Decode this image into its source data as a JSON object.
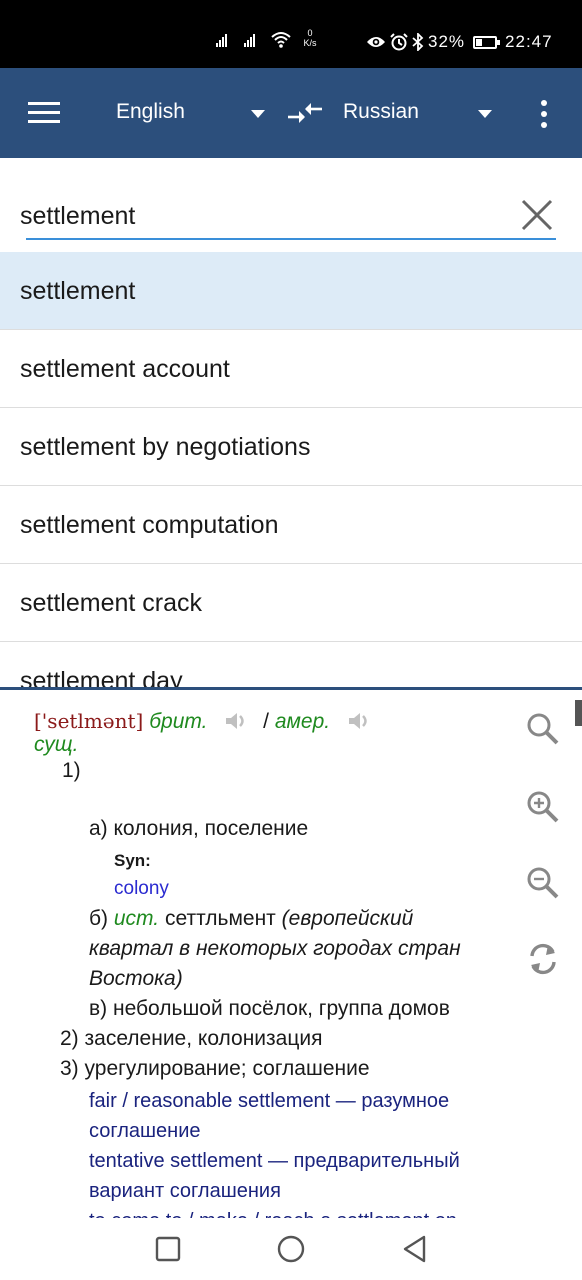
{
  "status_bar": {
    "signal_1": ".ıll",
    "signal_2": ".ıll",
    "net_speed_value": "0",
    "net_speed_unit": "K/s",
    "battery_text": "32%",
    "battery_level": 0.32,
    "time": "22:47",
    "icons": [
      "signal-icon",
      "signal-icon",
      "wifi-icon",
      "eye-icon",
      "alarm-icon",
      "bluetooth-icon",
      "battery-icon"
    ]
  },
  "app_bar": {
    "source_language": "English",
    "target_language": "Russian",
    "icons": [
      "menu-icon",
      "dropdown-icon",
      "swap-languages-icon",
      "dropdown-icon",
      "more-vert-icon"
    ]
  },
  "search": {
    "query": "settlement",
    "clear_icon": "close-icon",
    "underline_color": "#3a8fd9"
  },
  "suggestions": [
    "settlement",
    "settlement account",
    "settlement by negotiations",
    "settlement computation",
    "settlement crack",
    "settlement day"
  ],
  "article": {
    "transcription": "['setlmənt]",
    "brit_label": "брит.",
    "slash": "/",
    "amer_label": "амер.",
    "pos": "сущ.",
    "sense_1": "1)",
    "sense_1a": "а) колония, поселение",
    "syn_label": "Syn:",
    "syn_value": "colony",
    "sense_1b_prefix": "б)",
    "sense_1b_label": "ист.",
    "sense_1b_text": "сеттльмент",
    "sense_1b_note_1": "(европейский",
    "sense_1b_note_2": "квартал в некоторых городах стран",
    "sense_1b_note_3": "Востока)",
    "sense_1c": "в) небольшой посёлок, группа домов",
    "sense_2": "2) заселение, колонизация",
    "sense_3": "3) урегулирование; соглашение",
    "example_1a": "fair / reasonable settlement — разумное",
    "example_1b": "соглашение",
    "example_2a": "tentative settlement — предварительный",
    "example_2b": "вариант соглашения",
    "example_3a": "to come to / make / reach a settlement on"
  },
  "side_tools": [
    "search-icon",
    "zoom-in-icon",
    "zoom-out-icon",
    "refresh-icon"
  ],
  "nav_bar": [
    "recents-square-icon",
    "home-circle-icon",
    "back-triangle-icon"
  ],
  "colors": {
    "app_bar": "#2c4f7c",
    "selected_row": "#ddebf7",
    "transcription": "#8b1a1a",
    "label_green": "#1f8a1f",
    "link_blue": "#2a2ad0",
    "example_navy": "#1a237e"
  }
}
